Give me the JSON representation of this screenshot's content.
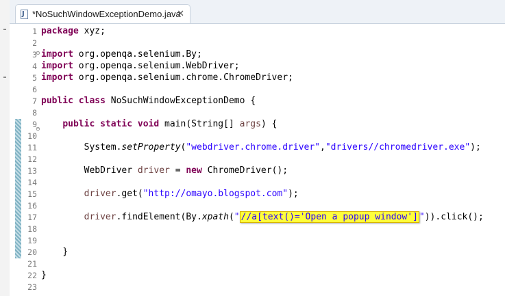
{
  "tab": {
    "title": "*NoSuchWindowExceptionDemo.java",
    "file_icon": "java-file-icon",
    "close_icon": "close-x-icon"
  },
  "line_numbers": [
    "1",
    "2",
    "3",
    "4",
    "5",
    "6",
    "7",
    "8",
    "9",
    "10",
    "11",
    "12",
    "13",
    "14",
    "15",
    "16",
    "17",
    "18",
    "19",
    "20",
    "21",
    "22",
    "23"
  ],
  "code": {
    "package_kw": "package",
    "package_name": " xyz;",
    "import_kw": "import",
    "import1": " org.openqa.selenium.By;",
    "import2": " org.openqa.selenium.WebDriver;",
    "import3": " org.openqa.selenium.chrome.ChromeDriver;",
    "public_kw": "public",
    "class_kw": "class",
    "class_name": " NoSuchWindowExceptionDemo {",
    "static_kw": "static",
    "void_kw": "void",
    "main_sig": " main(String[] ",
    "args": "args",
    "main_end": ") {",
    "system": "System.",
    "set_property": "setProperty",
    "paren_open": "(",
    "prop_key": "\"webdriver.chrome.driver\"",
    "comma": ",",
    "prop_val": "\"drivers//chromedriver.exe\"",
    "stmt_end": ");",
    "webdriver_type": "WebDriver ",
    "driver": "driver",
    "assign": " = ",
    "new_kw": "new",
    "chrome_ctor": " ChromeDriver();",
    "get_call": ".get(",
    "url": "\"http://omayo.blogspot.com\"",
    "find_call": ".findElement(By.",
    "xpath_method": "xpath",
    "quote": "\"",
    "xpath_expr": "//a[text()='Open a popup window']",
    "find_end": ")).click();",
    "close_brace": "}"
  },
  "highlight_color": "#ffff3a",
  "colors": {
    "keyword": "#7f0055",
    "string": "#2a00ff",
    "field": "#0000c0",
    "param": "#6a3e3e"
  }
}
